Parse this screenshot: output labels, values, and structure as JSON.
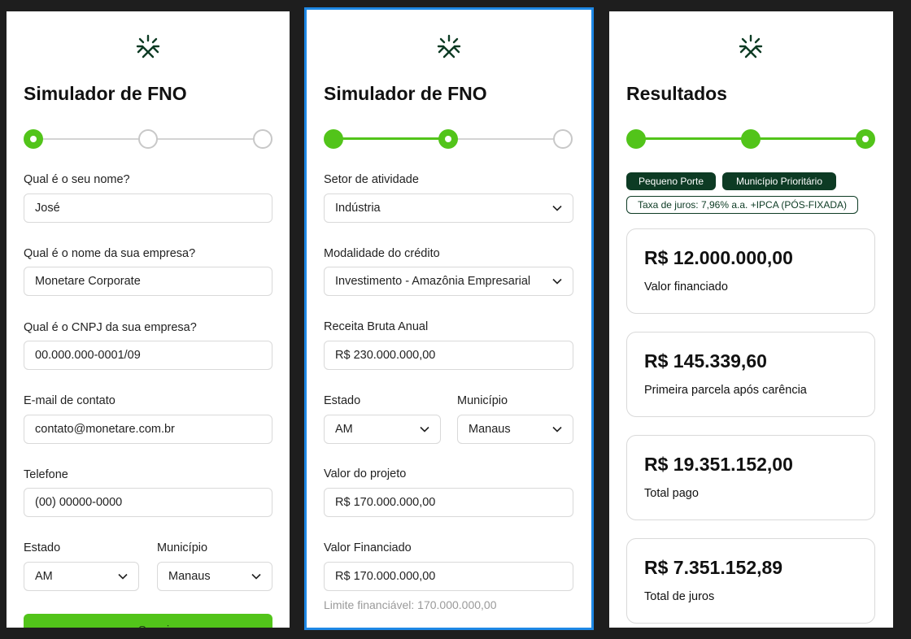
{
  "colors": {
    "accent_green": "#52c41a",
    "dark_green": "#0d3b24",
    "selection_blue": "#1e88e5"
  },
  "screen1": {
    "title": "Simulador de FNO",
    "step": 1,
    "fields": {
      "name": {
        "label": "Qual é o seu nome?",
        "value": "José"
      },
      "company": {
        "label": "Qual é o nome da sua empresa?",
        "value": "Monetare Corporate"
      },
      "cnpj": {
        "label": "Qual é o CNPJ da sua empresa?",
        "value": "00.000.000-0001/09"
      },
      "email": {
        "label": "E-mail de contato",
        "value": "contato@monetare.com.br"
      },
      "phone": {
        "label": "Telefone",
        "value": "(00) 00000-0000"
      },
      "state": {
        "label": "Estado",
        "value": "AM"
      },
      "city": {
        "label": "Município",
        "value": "Manaus"
      }
    },
    "next_button": "→ Seguir"
  },
  "screen2": {
    "title": "Simulador de FNO",
    "step": 2,
    "fields": {
      "sector": {
        "label": "Setor de atividade",
        "value": "Indústria"
      },
      "modality": {
        "label": "Modalidade do crédito",
        "value": "Investimento - Amazônia Empresarial"
      },
      "revenue": {
        "label": "Receita Bruta Anual",
        "value": "R$ 230.000.000,00"
      },
      "state": {
        "label": "Estado",
        "value": "AM"
      },
      "city": {
        "label": "Município",
        "value": "Manaus"
      },
      "project_value": {
        "label": "Valor do projeto",
        "value": "R$ 170.000.000,00"
      },
      "financed_value": {
        "label": "Valor Financiado",
        "value": "R$ 170.000.000,00"
      }
    },
    "limit_hint": "Limite financiável: 170.000.000,00"
  },
  "screen3": {
    "title": "Resultados",
    "step": 3,
    "badges": {
      "size": "Pequeno Porte",
      "priority": "Município Prioritário",
      "rate": "Taxa de juros: 7,96% a.a. +IPCA (PÓS-FIXADA)"
    },
    "results": [
      {
        "amount": "R$ 12.000.000,00",
        "label": "Valor financiado"
      },
      {
        "amount": "R$ 145.339,60",
        "label": "Primeira parcela após carência"
      },
      {
        "amount": "R$ 19.351.152,00",
        "label": "Total pago"
      },
      {
        "amount": "R$ 7.351.152,89",
        "label": "Total de juros"
      }
    ]
  }
}
